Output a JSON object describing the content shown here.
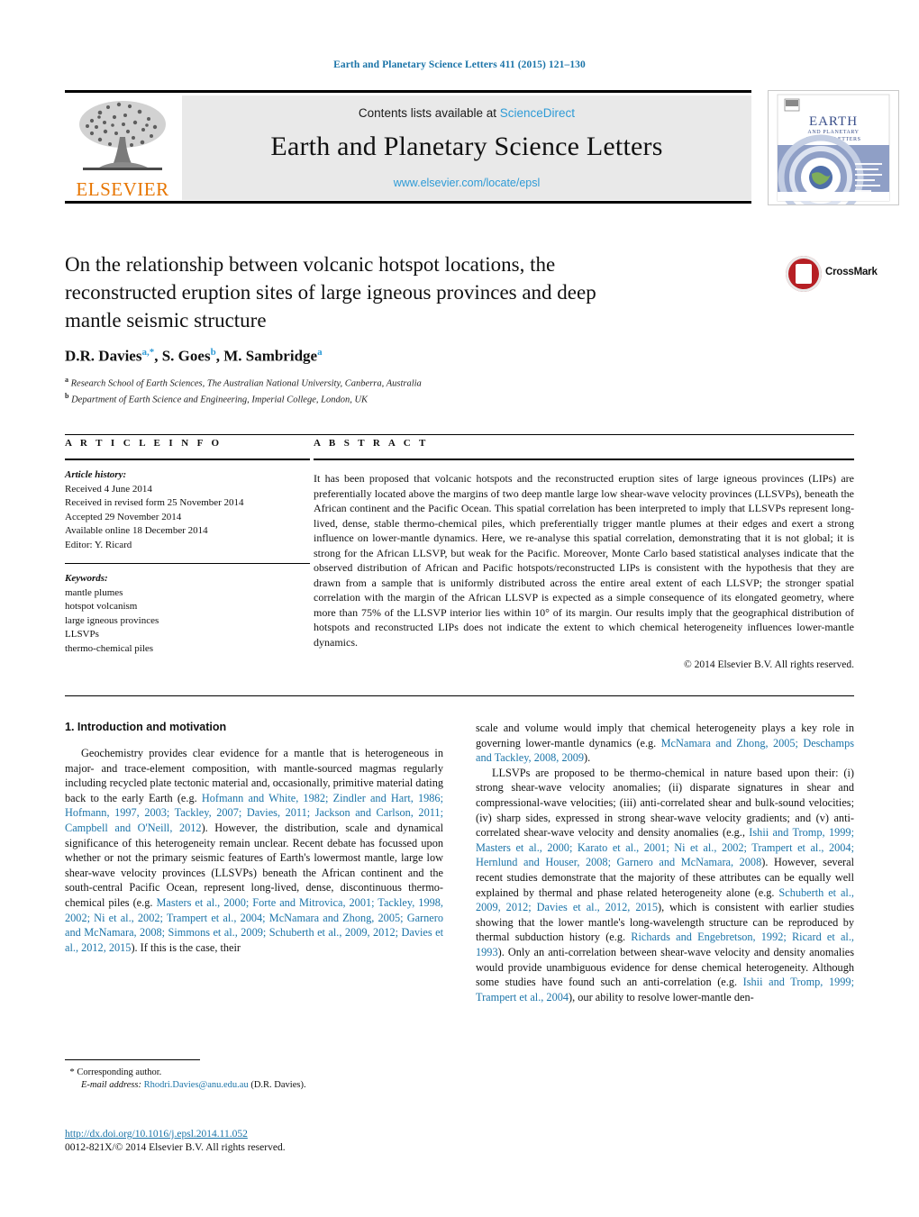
{
  "running_head": "Earth and Planetary Science Letters 411 (2015) 121–130",
  "masthead": {
    "contents_prefix": "Contents lists available at",
    "sciencedirect": "ScienceDirect",
    "journal_title": "Earth and Planetary Science Letters",
    "journal_url": "www.elsevier.com/locate/epsl",
    "publisher_wordmark": "ELSEVIER",
    "cover_title_line1": "EARTH",
    "cover_title_line2": "AND PLANETARY",
    "cover_title_line3": "SCIENCE LETTERS"
  },
  "article": {
    "title": "On the relationship between volcanic hotspot locations, the reconstructed eruption sites of large igneous provinces and deep mantle seismic structure",
    "crossmark_label": "CrossMark",
    "authors_html": "D.R. Davies<sup>a,*</sup>, S. Goes<sup>b</sup>, M. Sambridge<sup>a</sup>",
    "affiliation_a": "Research School of Earth Sciences, The Australian National University, Canberra, Australia",
    "affiliation_b": "Department of Earth Science and Engineering, Imperial College, London, UK"
  },
  "article_info": {
    "heading": "A R T I C L E    I N F O",
    "history_label": "Article history:",
    "history": [
      "Received 4 June 2014",
      "Received in revised form 25 November 2014",
      "Accepted 29 November 2014",
      "Available online 18 December 2014",
      "Editor: Y. Ricard"
    ],
    "keywords_label": "Keywords:",
    "keywords": [
      "mantle plumes",
      "hotspot volcanism",
      "large igneous provinces",
      "LLSVPs",
      "thermo-chemical piles"
    ]
  },
  "abstract": {
    "heading": "A B S T R A C T",
    "text": "It has been proposed that volcanic hotspots and the reconstructed eruption sites of large igneous provinces (LIPs) are preferentially located above the margins of two deep mantle large low shear-wave velocity provinces (LLSVPs), beneath the African continent and the Pacific Ocean. This spatial correlation has been interpreted to imply that LLSVPs represent long-lived, dense, stable thermo-chemical piles, which preferentially trigger mantle plumes at their edges and exert a strong influence on lower-mantle dynamics. Here, we re-analyse this spatial correlation, demonstrating that it is not global; it is strong for the African LLSVP, but weak for the Pacific. Moreover, Monte Carlo based statistical analyses indicate that the observed distribution of African and Pacific hotspots/reconstructed LIPs is consistent with the hypothesis that they are drawn from a sample that is uniformly distributed across the entire areal extent of each LLSVP; the stronger spatial correlation with the margin of the African LLSVP is expected as a simple consequence of its elongated geometry, where more than 75% of the LLSVP interior lies within 10° of its margin. Our results imply that the geographical distribution of hotspots and reconstructed LIPs does not indicate the extent to which chemical heterogeneity influences lower-mantle dynamics.",
    "copyright": "© 2014 Elsevier B.V. All rights reserved."
  },
  "body": {
    "section_title": "1. Introduction and motivation",
    "left_paragraphs": [
      {
        "segments": [
          {
            "t": "Geochemistry provides clear evidence for a mantle that is heterogeneous in major- and trace-element composition, with mantle-sourced magmas regularly including recycled plate tectonic material and, occasionally, primitive material dating back to the early Earth (e.g. ",
            "link": false
          },
          {
            "t": "Hofmann and White, 1982; Zindler and Hart, 1986; Hofmann, 1997, 2003; Tackley, 2007; Davies, 2011; Jackson and Carlson, 2011; Campbell and O'Neill, 2012",
            "link": true
          },
          {
            "t": "). However, the distribution, scale and dynamical significance of this heterogeneity remain unclear. Recent debate has focussed upon whether or not the primary seismic features of Earth's lowermost mantle, large low shear-wave velocity provinces (LLSVPs) beneath the African continent and the south-central Pacific Ocean, represent long-lived, dense, discontinuous thermo-chemical piles (e.g. ",
            "link": false
          },
          {
            "t": "Masters et al., 2000; Forte and Mitrovica, 2001; Tackley, 1998, 2002; Ni et al., 2002; Trampert et al., 2004; McNamara and Zhong, 2005; Garnero and McNamara, 2008; Simmons et al., 2009; Schuberth et al., 2009, 2012; Davies et al., 2012, 2015",
            "link": true
          },
          {
            "t": "). If this is the case, their",
            "link": false
          }
        ]
      }
    ],
    "right_paragraphs": [
      {
        "continuation": true,
        "segments": [
          {
            "t": "scale and volume would imply that chemical heterogeneity plays a key role in governing lower-mantle dynamics (e.g. ",
            "link": false
          },
          {
            "t": "McNamara and Zhong, 2005; Deschamps and Tackley, 2008, 2009",
            "link": true
          },
          {
            "t": ").",
            "link": false
          }
        ]
      },
      {
        "continuation": false,
        "segments": [
          {
            "t": "LLSVPs are proposed to be thermo-chemical in nature based upon their: (i) strong shear-wave velocity anomalies; (ii) disparate signatures in shear and compressional-wave velocities; (iii) anti-correlated shear and bulk-sound velocities; (iv) sharp sides, expressed in strong shear-wave velocity gradients; and (v) anti-correlated shear-wave velocity and density anomalies (e.g., ",
            "link": false
          },
          {
            "t": "Ishii and Tromp, 1999; Masters et al., 2000; Karato et al., 2001; Ni et al., 2002; Trampert et al., 2004; Hernlund and Houser, 2008; Garnero and McNamara, 2008",
            "link": true
          },
          {
            "t": "). However, several recent studies demonstrate that the majority of these attributes can be equally well explained by thermal and phase related heterogeneity alone (e.g. ",
            "link": false
          },
          {
            "t": "Schuberth et al., 2009, 2012; Davies et al., 2012, 2015",
            "link": true
          },
          {
            "t": "), which is consistent with earlier studies showing that the lower mantle's long-wavelength structure can be reproduced by thermal subduction history (e.g. ",
            "link": false
          },
          {
            "t": "Richards and Engebretson, 1992; Ricard et al., 1993",
            "link": true
          },
          {
            "t": "). Only an anti-correlation between shear-wave velocity and density anomalies would provide unambiguous evidence for dense chemical heterogeneity. Although some studies have found such an anti-correlation (e.g. ",
            "link": false
          },
          {
            "t": "Ishii and Tromp, 1999; Trampert et al., 2004",
            "link": true
          },
          {
            "t": "), our ability to resolve lower-mantle den-",
            "link": false
          }
        ]
      }
    ]
  },
  "footnote": {
    "corresponding_marker": "*",
    "corresponding_text": "Corresponding author.",
    "email_label": "E-mail address:",
    "email": "Rhodri.Davies@anu.edu.au",
    "email_owner": "(D.R. Davies).",
    "doi": "http://dx.doi.org/10.1016/j.epsl.2014.11.052",
    "issn_line": "0012-821X/© 2014 Elsevier B.V. All rights reserved."
  },
  "colors": {
    "link": "#1b74a8",
    "sciencedirect": "#2e9bd6",
    "elsevier_orange": "#e77500",
    "crossmark_red": "#b61f24"
  }
}
